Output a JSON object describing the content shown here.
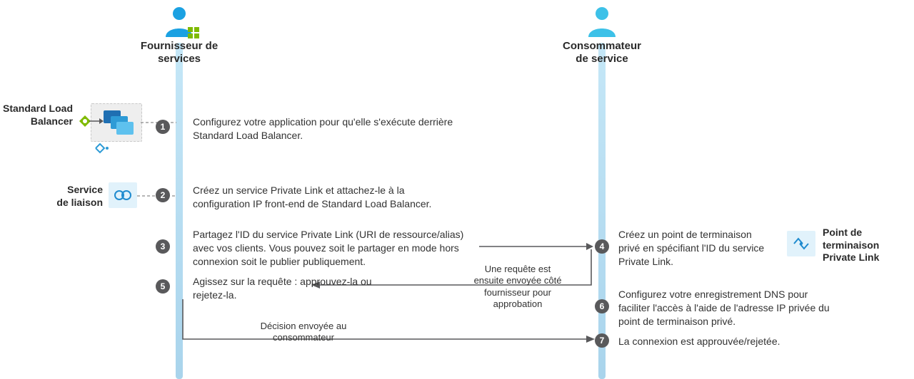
{
  "actors": {
    "provider": {
      "label_l1": "Fournisseur de",
      "label_l2": "services"
    },
    "consumer": {
      "label_l1": "Consommateur",
      "label_l2": "de service"
    }
  },
  "side_labels": {
    "slb_l1": "Standard Load",
    "slb_l2": "Balancer",
    "link_service_l1": "Service",
    "link_service_l2": "de liaison",
    "pe_l1": "Point de",
    "pe_l2": "terminaison",
    "pe_l3": "Private Link"
  },
  "steps": {
    "s1": {
      "num": "1",
      "text": "Configurez votre application pour qu'elle s'exécute derrière Standard Load Balancer."
    },
    "s2": {
      "num": "2",
      "text": "Créez un service Private Link et attachez-le à la configuration IP front-end de Standard Load Balancer."
    },
    "s3": {
      "num": "3",
      "text": "Partagez l'ID du service Private Link (URI de ressource/alias) avec vos clients. Vous pouvez soit le partager en mode hors connexion soit le publier publiquement."
    },
    "s4": {
      "num": "4",
      "text": "Créez un point de terminaison privé en spécifiant l'ID du service Private Link."
    },
    "s5": {
      "num": "5",
      "text": "Agissez sur la requête : approuvez-la ou rejetez-la."
    },
    "s6": {
      "num": "6",
      "text": "Configurez votre enregistrement DNS pour faciliter l'accès à l'aide de l'adresse IP privée du point de terminaison privé."
    },
    "s7": {
      "num": "7",
      "text": "La connexion est approuvée/rejetée."
    }
  },
  "arrows": {
    "req_l1": "Une requête est",
    "req_l2": "ensuite envoyée côté",
    "req_l3": "fournisseur pour",
    "req_l4": "approbation",
    "dec_l1": "Décision envoyée au",
    "dec_l2": "consommateur"
  },
  "icons": {
    "provider_person": "provider-person-icon",
    "consumer_person": "consumer-person-icon",
    "grid_badge": "servers-grid-icon",
    "slb_diamond": "load-balancer-icon",
    "vm_stack": "vm-group-icon",
    "link_service": "private-link-service-icon",
    "private_endpoint": "private-endpoint-icon"
  }
}
